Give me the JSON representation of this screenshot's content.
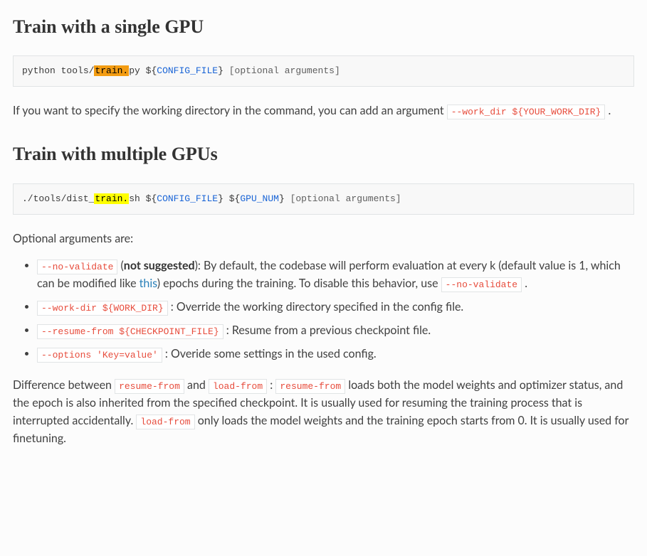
{
  "section1": {
    "heading": "Train with a single GPU",
    "code": {
      "prefix": "python tools/",
      "highlight": "train.",
      "after_hl": "py ",
      "dollar": "$",
      "lbrace": "{",
      "var": "CONFIG_FILE",
      "rbrace": "}",
      "space": " ",
      "optional": "[optional arguments]"
    },
    "para_before_code": "If you want to specify the working directory in the command, you can add an argument ",
    "para_code": "--work_dir ${YOUR_WORK_DIR}",
    "para_after_code": " ."
  },
  "section2": {
    "heading": "Train with multiple GPUs",
    "code": {
      "prefix": "./tools/dist_",
      "highlight": "train.",
      "after_hl": "sh ",
      "d1": "$",
      "lb1": "{",
      "v1": "CONFIG_FILE",
      "rb1": "}",
      "sp": " ",
      "d2": "$",
      "lb2": "{",
      "v2": "GPU_NUM",
      "rb2": "}",
      "sp2": " ",
      "optional": "[optional arguments]"
    },
    "optional_intro": "Optional arguments are:",
    "items": [
      {
        "code": "--no-validate",
        "pre": " (",
        "strong": "not suggested",
        "mid": "): By default, the codebase will perform evaluation at every k (default value is 1, which can be modified like ",
        "link": "this",
        "post_link": ") epochs during the training. To disable this behavior, use ",
        "code2": "--no-validate",
        "tail": " ."
      },
      {
        "code": "--work-dir ${WORK_DIR}",
        "text": " : Override the working directory specified in the config file."
      },
      {
        "code": "--resume-from ${CHECKPOINT_FILE}",
        "text": " : Resume from a previous checkpoint file."
      },
      {
        "code": "--options 'Key=value'",
        "text": " : Overide some settings in the used config."
      }
    ],
    "diff": {
      "t0": "Difference between ",
      "c0": "resume-from",
      "t1": "  and ",
      "c1": "load-from",
      "t2": " : ",
      "c2": "resume-from",
      "t3": "  loads both the model weights and optimizer status, and the epoch is also inherited from the specified checkpoint. It is usually used for resuming the training process that is interrupted accidentally. ",
      "c3": "load-from",
      "t4": "  only loads the model weights and the training epoch starts from 0. It is usually used for finetuning."
    }
  }
}
